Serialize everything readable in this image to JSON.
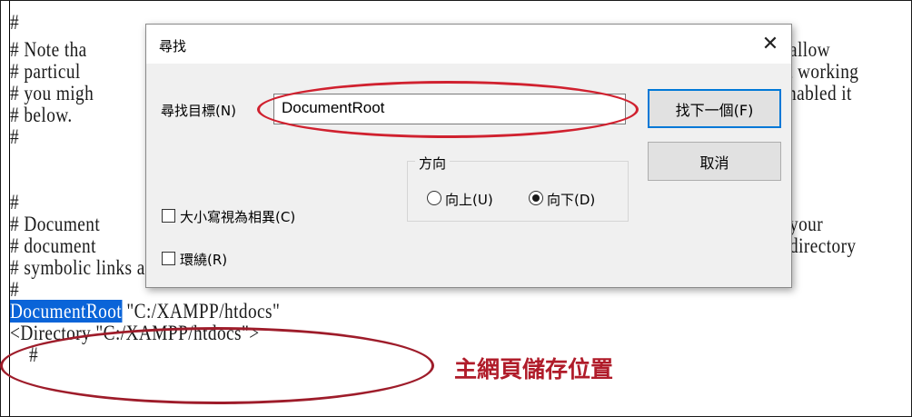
{
  "editor": {
    "lines": [
      "#",
      "# Note tha",
      "# particul",
      "# you migh",
      "# below.",
      "#",
      "",
      "",
      "#",
      "# Document",
      "# document",
      "# symbolic links and aliases may be used to point to other locations.",
      "#",
      "",
      "<Directory \"C:/XAMPP/htdocs\">",
      "    #"
    ],
    "right_fragments": [
      "allow",
      "t working",
      "nabled it",
      "your",
      "directory"
    ],
    "docroot_keyword": "DocumentRoot",
    "docroot_value": " \"C:/XAMPP/htdocs\""
  },
  "annotation": {
    "label": "主網頁儲存位置",
    "color": "#b01c2a"
  },
  "dialog": {
    "title": "尋找",
    "close_glyph": "✕",
    "find_label": "尋找目標(N)",
    "find_value": "DocumentRoot",
    "find_next_label": "找下一個(F)",
    "cancel_label": "取消",
    "match_case_label": "大小寫視為相異(C)",
    "wrap_label": "環繞(R)",
    "direction": {
      "legend": "方向",
      "up_label": "向上(U)",
      "down_label": "向下(D)",
      "selected": "down"
    }
  }
}
